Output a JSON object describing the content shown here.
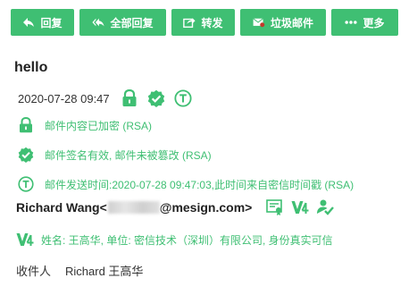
{
  "toolbar": {
    "reply": {
      "label": "回复",
      "icon": "reply-icon"
    },
    "reply_all": {
      "label": "全部回复",
      "icon": "reply-all-icon"
    },
    "forward": {
      "label": "转发",
      "icon": "forward-icon"
    },
    "spam": {
      "label": "垃圾邮件",
      "icon": "spam-mail-icon"
    },
    "more": {
      "label": "更多",
      "icon": "more-dots-icon"
    }
  },
  "mail": {
    "subject": "hello",
    "date": "2020-07-28 09:47",
    "status": {
      "encrypted": "邮件内容已加密 (RSA)",
      "signature": "邮件签名有效, 邮件未被篡改 (RSA)",
      "timestamp": "邮件发送时间:2020-07-28 09:47:03,此时间来自密信时间戳 (RSA)"
    },
    "sender": {
      "name": "Richard Wang",
      "open_bracket": "<",
      "email_domain": "@mesign.com>"
    },
    "identity": "姓名: 王高华, 单位: 密信技术（深圳）有限公司, 身份真实可信",
    "recipients": {
      "label": "收件人",
      "value": "Richard 王高华"
    }
  },
  "colors": {
    "accent": "#3fbf73",
    "text": "#333333",
    "title": "#222222",
    "background": "#ffffff"
  }
}
